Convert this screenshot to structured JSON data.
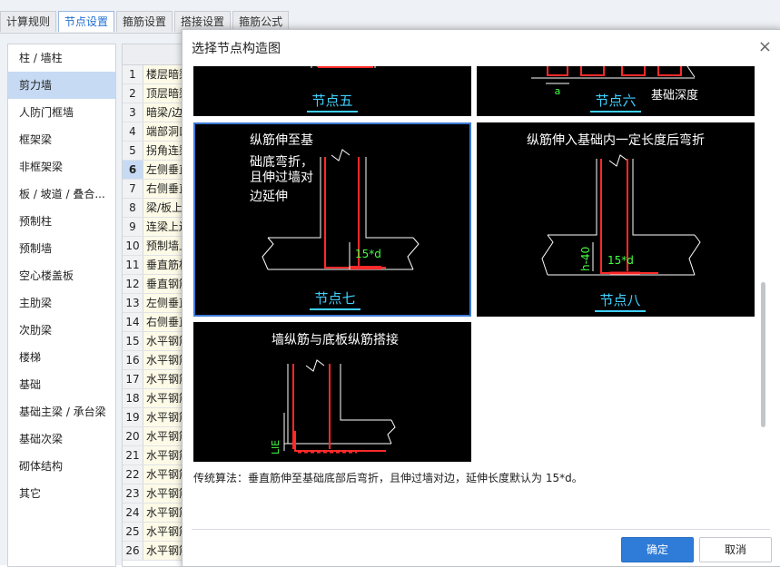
{
  "tabs": [
    "计算规则",
    "节点设置",
    "箍筋设置",
    "搭接设置",
    "箍筋公式"
  ],
  "sidebar": {
    "items": [
      "柱 / 墙柱",
      "剪力墙",
      "人防门框墙",
      "框架梁",
      "非框架梁",
      "板 / 坡道 / 叠合...",
      "预制柱",
      "预制墙",
      "空心楼盖板",
      "主肋梁",
      "次肋梁",
      "楼梯",
      "基础",
      "基础主梁 / 承台梁",
      "基础次梁",
      "砌体结构",
      "其它"
    ],
    "selected": "剪力墙"
  },
  "grid": {
    "rows": [
      {
        "num": "1",
        "text": "楼层暗梁"
      },
      {
        "num": "2",
        "text": "顶层暗梁"
      },
      {
        "num": "3",
        "text": "暗梁/边框"
      },
      {
        "num": "4",
        "text": "端部洞口"
      },
      {
        "num": "5",
        "text": "拐角连梁"
      },
      {
        "num": "6",
        "text": "左侧垂直"
      },
      {
        "num": "7",
        "text": "右侧垂直"
      },
      {
        "num": "8",
        "text": "梁/板上"
      },
      {
        "num": "9",
        "text": "连梁上边"
      },
      {
        "num": "10",
        "text": "预制墙上"
      },
      {
        "num": "11",
        "text": "垂直筋构"
      },
      {
        "num": "12",
        "text": "垂直钢筋"
      },
      {
        "num": "13",
        "text": "左侧垂直"
      },
      {
        "num": "14",
        "text": "右侧垂直"
      },
      {
        "num": "15",
        "text": "水平钢筋"
      },
      {
        "num": "16",
        "text": "水平钢筋"
      },
      {
        "num": "17",
        "text": "水平钢筋"
      },
      {
        "num": "18",
        "text": "水平钢筋"
      },
      {
        "num": "19",
        "text": "水平钢筋"
      },
      {
        "num": "20",
        "text": "水平钢筋"
      },
      {
        "num": "21",
        "text": "水平钢筋"
      },
      {
        "num": "22",
        "text": "水平钢筋"
      },
      {
        "num": "23",
        "text": "水平钢筋"
      },
      {
        "num": "24",
        "text": "水平钢筋"
      },
      {
        "num": "25",
        "text": "水平钢筋"
      },
      {
        "num": "26",
        "text": "水平钢筋"
      }
    ],
    "highlight": "6"
  },
  "dialog": {
    "title": "选择节点构造图",
    "close": "×",
    "node5_label": "节点五",
    "node6_label": "节点六",
    "node6_a": "a",
    "node6_depth": "基础深度",
    "node7_text": [
      "纵筋伸至基",
      "础底弯折，",
      "且伸过墙对",
      "边延伸"
    ],
    "node7_dim": "15*d",
    "node7_label": "节点七",
    "node8_text": "纵筋伸入基础内一定长度后弯折",
    "node8_dim": "15*d",
    "node8_h": "h-40",
    "node8_label": "节点八",
    "node9_text": "墙纵筋与底板纵筋搭接",
    "node9_lle": "LlE",
    "description": "传统算法：垂直筋伸至基础底部后弯折，且伸过墙对边，延伸长度默认为 15*d。",
    "ok": "确定",
    "cancel": "取消"
  },
  "colors": {
    "accent": "#2f7cd8",
    "node_label": "#3fd0ff",
    "rebar": "#ff2a2a",
    "dim": "#44ff44"
  }
}
